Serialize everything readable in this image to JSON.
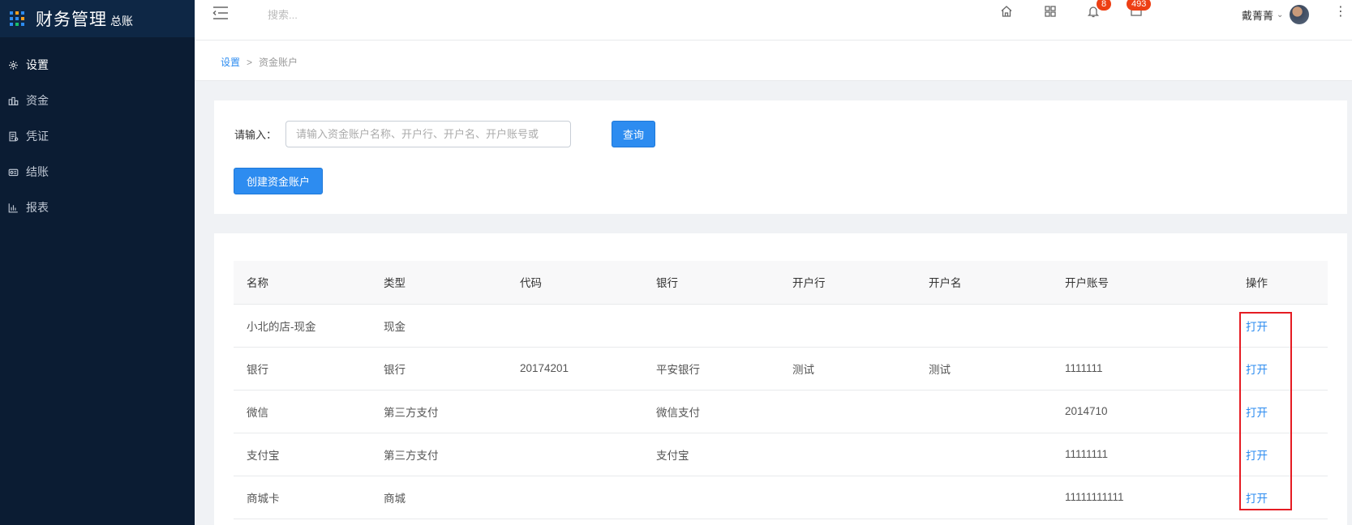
{
  "app": {
    "title": "财务管理",
    "subtitle": "总账"
  },
  "sidebar": {
    "items": [
      {
        "label": "设置",
        "icon": "gear-icon",
        "active": true
      },
      {
        "label": "资金",
        "icon": "funds-icon",
        "active": false
      },
      {
        "label": "凭证",
        "icon": "voucher-icon",
        "active": false
      },
      {
        "label": "结账",
        "icon": "checkout-icon",
        "active": false
      },
      {
        "label": "报表",
        "icon": "bar-chart-icon",
        "active": false
      }
    ]
  },
  "header": {
    "search_placeholder": "搜索...",
    "notifications_count": "8",
    "messages_count": "493",
    "user_name": "戴菁菁"
  },
  "breadcrumb": {
    "root": "设置",
    "separator": ">",
    "current": "资金账户"
  },
  "query": {
    "label": "请输入：",
    "placeholder": "请输入资金账户名称、开户行、开户名、开户账号或",
    "value": "",
    "search_button": "查询",
    "create_button": "创建资金账户"
  },
  "table": {
    "columns": [
      "名称",
      "类型",
      "代码",
      "银行",
      "开户行",
      "开户名",
      "开户账号",
      "操作"
    ],
    "rows": [
      {
        "name": "小北的店-现金",
        "type": "现金",
        "code": "",
        "bank": "",
        "branch": "",
        "holder": "",
        "account": "",
        "action": "打开"
      },
      {
        "name": "银行",
        "type": "银行",
        "code": "20174201",
        "bank": "平安银行",
        "branch": "测试",
        "holder": "测试",
        "account": "1111111",
        "action": "打开"
      },
      {
        "name": "微信",
        "type": "第三方支付",
        "code": "",
        "bank": "微信支付",
        "branch": "",
        "holder": "",
        "account": "2014710",
        "action": "打开"
      },
      {
        "name": "支付宝",
        "type": "第三方支付",
        "code": "",
        "bank": "支付宝",
        "branch": "",
        "holder": "",
        "account": "11111111",
        "action": "打开"
      },
      {
        "name": "商城卡",
        "type": "商城",
        "code": "",
        "bank": "",
        "branch": "",
        "holder": "",
        "account": "11111111111",
        "action": "打开"
      }
    ]
  },
  "colors": {
    "sidebar_bg": "#0b1c33",
    "primary": "#2d8cf0",
    "badge": "#ed3f14",
    "highlight": "#e51c23"
  }
}
